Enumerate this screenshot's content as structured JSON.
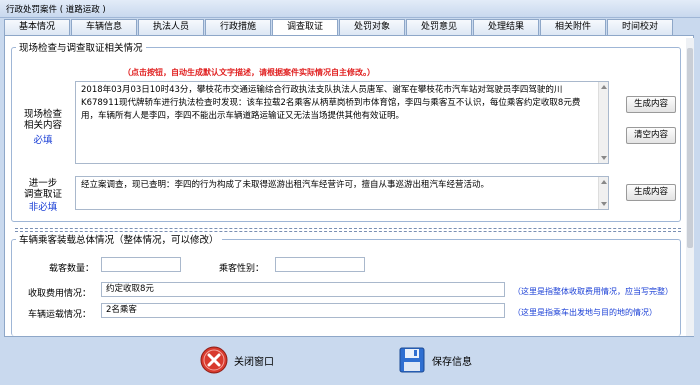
{
  "window": {
    "title": "行政处罚案件 ( 道路运政 )"
  },
  "tabs": [
    "基本情况",
    "车辆信息",
    "执法人员",
    "行政措施",
    "调查取证",
    "处罚对象",
    "处罚意见",
    "处理结果",
    "相关附件",
    "时间校对"
  ],
  "section1": {
    "legend": "现场检查与调查取证相关情况",
    "hint": "（点击按钮，自动生成默认文字描述，请根据案件实际情况自主修改。）",
    "inspect": {
      "label_l1": "现场检查",
      "label_l2": "相关内容",
      "required": "必填",
      "text": "2018年03月03日10时43分，攀枝花市交通运输综合行政执法支队执法人员唐军、谢军在攀枝花市汽车站对驾驶员李四驾驶的川K678911现代牌轿车进行执法检查时发现：该车拉载2名乘客从柄草岗桥到市体育馆，李四与乘客互不认识，每位乘客约定收取8元费用，车辆所有人是李四，李四不能出示车辆道路运输证又无法当场提供其他有效证明。",
      "btn_generate": "生成内容",
      "btn_clear": "清空内容"
    },
    "further": {
      "label_l1": "进一步",
      "label_l2": "调查取证",
      "optional": "非必填",
      "text": "经立案调查，现已查明：李四的行为构成了未取得巡游出租汽车经营许可，擅自从事巡游出租汽车经营活动。",
      "btn_generate": "生成内容"
    }
  },
  "section2": {
    "legend": "车辆乘客装载总体情况（整体情况，可以修改）",
    "passenger_count_label": "载客数量：",
    "passenger_count_value": "",
    "passenger_gender_label": "乘客性别：",
    "passenger_gender_value": "",
    "fee_label": "收取费用情况：",
    "fee_value": "约定收取8元",
    "fee_note": "（这里是指整体收取费用情况，应当写完整）",
    "route_label": "车辆运载情况：",
    "route_value": "2名乘客",
    "route_note": "（这里是指乘车出发地与目的地的情况）"
  },
  "footer": {
    "close_label": "关闭窗口",
    "save_label": "保存信息"
  }
}
